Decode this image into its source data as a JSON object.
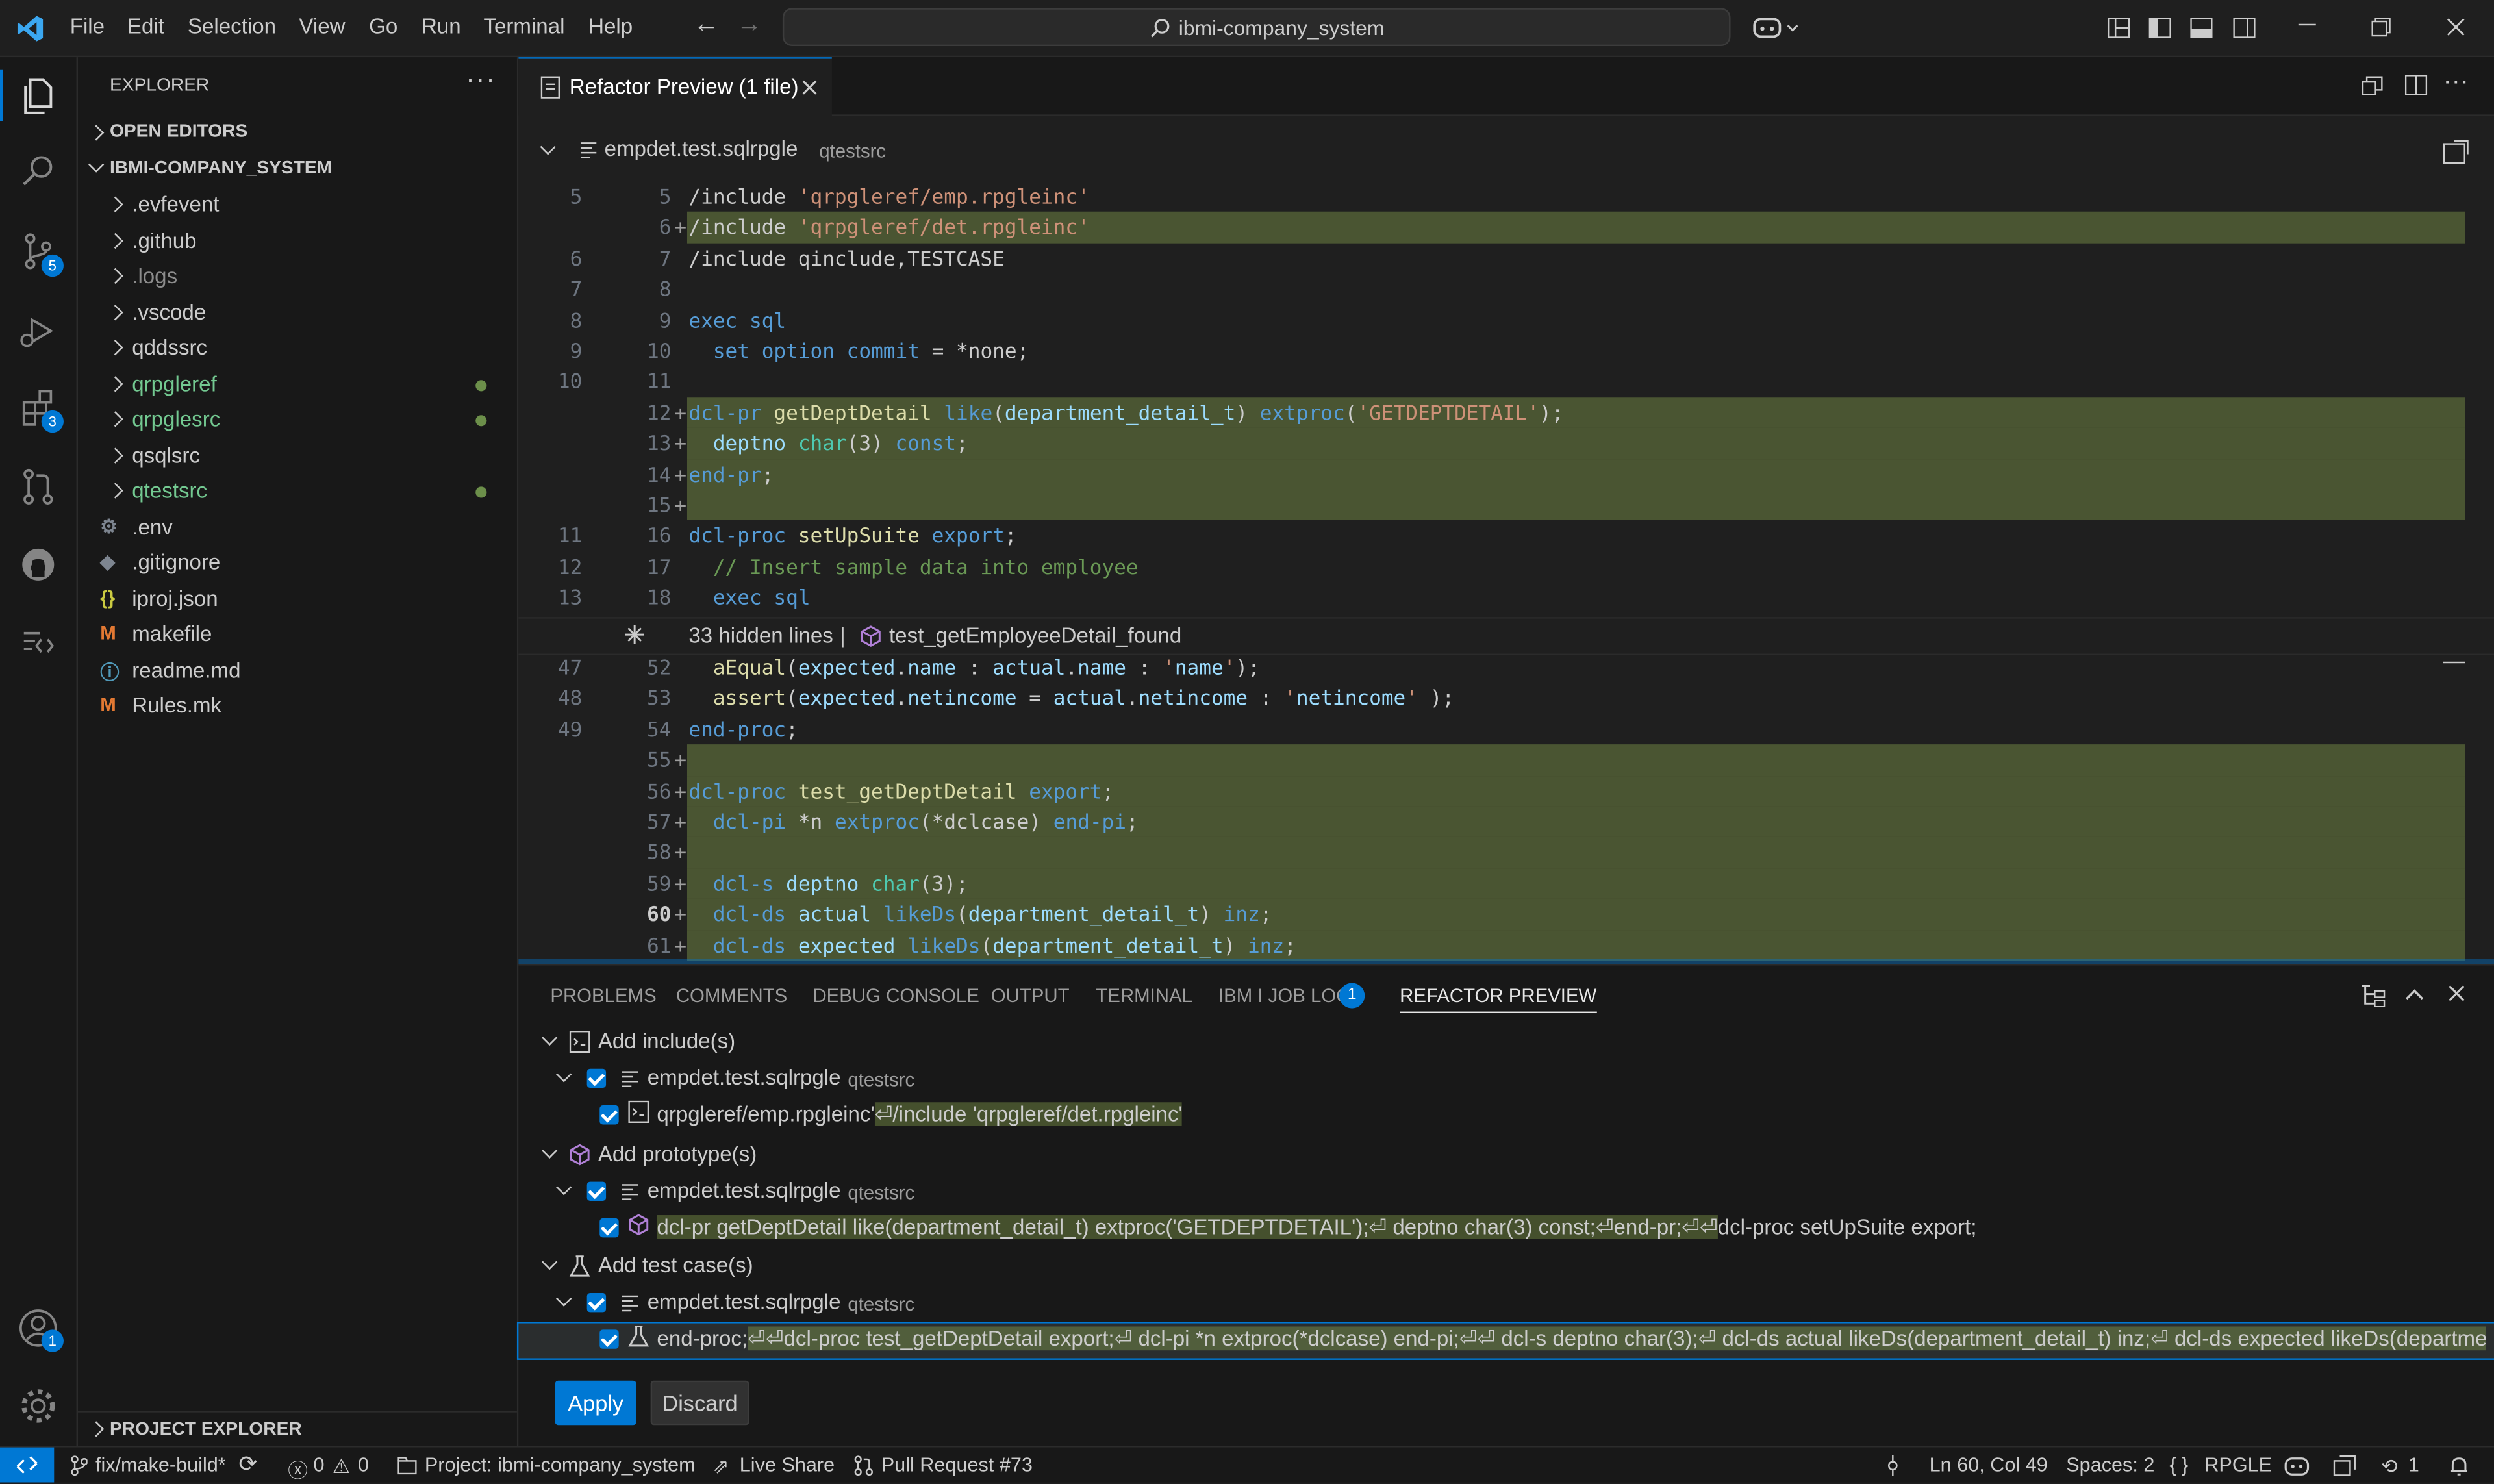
{
  "menu": [
    "File",
    "Edit",
    "Selection",
    "View",
    "Go",
    "Run",
    "Terminal",
    "Help"
  ],
  "search": {
    "text": "ibmi-company_system"
  },
  "activity": {
    "scm_badge": "5",
    "ext_badge": "3",
    "account_badge": "1"
  },
  "sidebar": {
    "title": "EXPLORER",
    "open_editors": "OPEN EDITORS",
    "root": "IBMI-COMPANY_SYSTEM",
    "items": [
      {
        "label": ".evfevent",
        "kind": "folder"
      },
      {
        "label": ".github",
        "kind": "folder"
      },
      {
        "label": ".logs",
        "kind": "folder"
      },
      {
        "label": ".vscode",
        "kind": "folder"
      },
      {
        "label": "qddssrc",
        "kind": "folder"
      },
      {
        "label": "qrpgleref",
        "kind": "folder-modified"
      },
      {
        "label": "qrpglesrc",
        "kind": "folder-modified"
      },
      {
        "label": "qsqlsrc",
        "kind": "folder"
      },
      {
        "label": "qtestsrc",
        "kind": "folder-modified"
      },
      {
        "label": ".env",
        "kind": "file"
      },
      {
        "label": ".gitignore",
        "kind": "file"
      },
      {
        "label": "iproj.json",
        "kind": "file"
      },
      {
        "label": "makefile",
        "kind": "file"
      },
      {
        "label": "readme.md",
        "kind": "file"
      },
      {
        "label": "Rules.mk",
        "kind": "file"
      }
    ],
    "project_explorer": "PROJECT EXPLORER"
  },
  "editor": {
    "tab": "Refactor Preview (1 file)",
    "file": "empdet.test.sqlrpgle",
    "file_dir": "qtestsrc",
    "hidden": "33 hidden lines",
    "hidden_sep": "|",
    "hidden_test": "test_getEmployeeDetail_found",
    "lines": [
      {
        "o": "5",
        "n": "5",
        "m": "",
        "code": "/include 'qrpgleref/emp.rpgleinc'"
      },
      {
        "o": "",
        "n": "6",
        "m": "+",
        "code": "/include 'qrpgleref/det.rpgleinc'"
      },
      {
        "o": "6",
        "n": "7",
        "m": "",
        "code": "/include qinclude,TESTCASE"
      },
      {
        "o": "7",
        "n": "8",
        "m": "",
        "code": ""
      },
      {
        "o": "8",
        "n": "9",
        "m": "",
        "code": "exec sql"
      },
      {
        "o": "9",
        "n": "10",
        "m": "",
        "code": "  set option commit = *none;"
      },
      {
        "o": "10",
        "n": "11",
        "m": "",
        "code": ""
      },
      {
        "o": "",
        "n": "12",
        "m": "+",
        "code": "dcl-pr getDeptDetail like(department_detail_t) extproc('GETDEPTDETAIL');"
      },
      {
        "o": "",
        "n": "13",
        "m": "+",
        "code": "  deptno char(3) const;"
      },
      {
        "o": "",
        "n": "14",
        "m": "+",
        "code": "end-pr;"
      },
      {
        "o": "",
        "n": "15",
        "m": "+",
        "code": ""
      },
      {
        "o": "11",
        "n": "16",
        "m": "",
        "code": "dcl-proc setUpSuite export;"
      },
      {
        "o": "12",
        "n": "17",
        "m": "",
        "code": "  // Insert sample data into employee"
      },
      {
        "o": "13",
        "n": "18",
        "m": "",
        "code": "  exec sql"
      },
      {
        "o": "47",
        "n": "52",
        "m": "",
        "code": "  aEqual(expected.name : actual.name : 'name');"
      },
      {
        "o": "48",
        "n": "53",
        "m": "",
        "code": "  assert(expected.netincome = actual.netincome : 'netincome' );"
      },
      {
        "o": "49",
        "n": "54",
        "m": "",
        "code": "end-proc;"
      },
      {
        "o": "",
        "n": "55",
        "m": "+",
        "code": ""
      },
      {
        "o": "",
        "n": "56",
        "m": "+",
        "code": "dcl-proc test_getDeptDetail export;"
      },
      {
        "o": "",
        "n": "57",
        "m": "+",
        "code": "  dcl-pi *n extproc(*dclcase) end-pi;"
      },
      {
        "o": "",
        "n": "58",
        "m": "+",
        "code": ""
      },
      {
        "o": "",
        "n": "59",
        "m": "+",
        "code": "  dcl-s deptno char(3);"
      },
      {
        "o": "",
        "n": "60",
        "m": "+",
        "code": "  dcl-ds actual likeDs(department_detail_t) inz;"
      },
      {
        "o": "",
        "n": "61",
        "m": "+",
        "code": "  dcl-ds expected likeDs(department_detail_t) inz;"
      }
    ]
  },
  "panel": {
    "tabs": [
      "PROBLEMS",
      "COMMENTS",
      "DEBUG CONSOLE",
      "OUTPUT",
      "TERMINAL",
      "IBM I JOB LOG",
      "REFACTOR PREVIEW"
    ],
    "joblog_badge": "1",
    "groups": [
      {
        "label": "Add include(s)",
        "file": "empdet.test.sqlrpgle",
        "dir": "qtestsrc",
        "pre": "qrpgleref/emp.rpgleinc'",
        "change": "⏎/include 'qrpgleref/det.rpgleinc'",
        "post": ""
      },
      {
        "label": "Add prototype(s)",
        "file": "empdet.test.sqlrpgle",
        "dir": "qtestsrc",
        "pre": "",
        "change": "dcl-pr getDeptDetail like(department_detail_t) extproc('GETDEPTDETAIL');⏎ deptno char(3) const;⏎end-pr;⏎⏎",
        "post": "dcl-proc setUpSuite export;"
      },
      {
        "label": "Add test case(s)",
        "file": "empdet.test.sqlrpgle",
        "dir": "qtestsrc",
        "pre": "end-proc;",
        "change": "⏎⏎dcl-proc test_getDeptDetail export;⏎ dcl-pi *n extproc(*dclcase) end-pi;⏎⏎ dcl-s deptno char(3);⏎ dcl-ds actual likeDs(department_detail_t) inz;⏎ dcl-ds expected likeDs(department_...",
        "post": ""
      }
    ],
    "apply": "Apply",
    "discard": "Discard"
  },
  "status": {
    "branch": "fix/make-build*",
    "errors": "0",
    "warnings": "0",
    "project": "Project: ibmi-company_system",
    "liveshare": "Live Share",
    "pr": "Pull Request #73",
    "position": "Ln 60, Col 49",
    "spaces": "Spaces: 2",
    "lang": "RPGLE",
    "history": "1"
  },
  "colors": {
    "accent": "#0078d4",
    "added": "#9bb955",
    "modified": "#73c991",
    "bg": "#1f1f1f"
  }
}
